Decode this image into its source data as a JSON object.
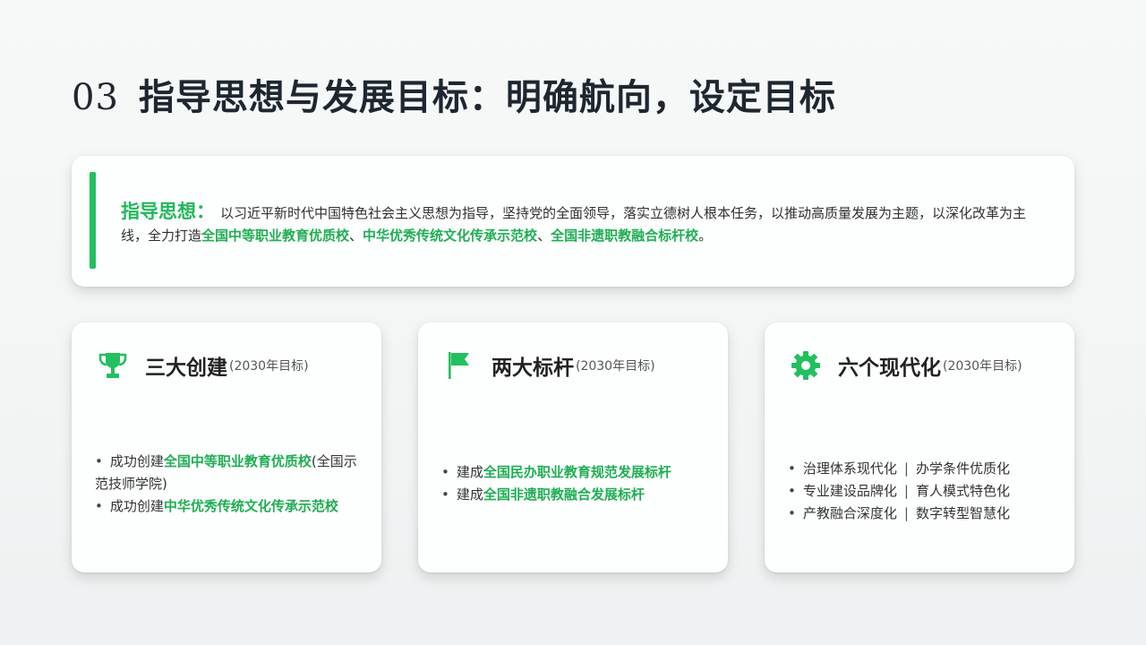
{
  "slide": {
    "number": "03",
    "title": "指导思想与发展目标：明确航向，设定目标"
  },
  "guide": {
    "label": "指导思想：",
    "text_1": "以习近平新时代中国特色社会主义思想为指导，坚持党的全面领导，落实立德树人根本任务，以推动高质量发展为主题，以深化改革为主线，全力打造",
    "hl_1": "全国中等职业教育优质校",
    "sep_1": "、",
    "hl_2": "中华优秀传统文化传承示范校",
    "sep_2": "、",
    "hl_3": "全国非遗职教融合标杆校",
    "end": "。"
  },
  "colors": {
    "accent": "#22c05e",
    "highlight": "#1fae52",
    "title": "#1e2630"
  },
  "goals": [
    {
      "icon": "trophy-icon",
      "title": "三大创建",
      "sub": "(2030年目标)",
      "items": [
        {
          "prefix": "成功创建",
          "hl": "全国中等职业教育优质校",
          "suffix": "(全国示范技师学院)"
        },
        {
          "prefix": "成功创建",
          "hl": "中华优秀传统文化传承示范校",
          "suffix": ""
        }
      ]
    },
    {
      "icon": "flag-icon",
      "title": "两大标杆",
      "sub": "(2030年目标)",
      "items": [
        {
          "prefix": "建成",
          "hl": "全国民办职业教育规范发展标杆",
          "suffix": ""
        },
        {
          "prefix": "建成",
          "hl": "全国非遗职教融合发展标杆",
          "suffix": ""
        }
      ]
    },
    {
      "icon": "gear-icon",
      "title": "六个现代化",
      "sub": "(2030年目标)",
      "items": [
        {
          "a": "治理体系现代化",
          "sep": "|",
          "b": "办学条件优质化"
        },
        {
          "a": "专业建设品牌化",
          "sep": "|",
          "b": "育人模式特色化"
        },
        {
          "a": "产教融合深度化",
          "sep": "|",
          "b": "数字转型智慧化"
        }
      ]
    }
  ]
}
